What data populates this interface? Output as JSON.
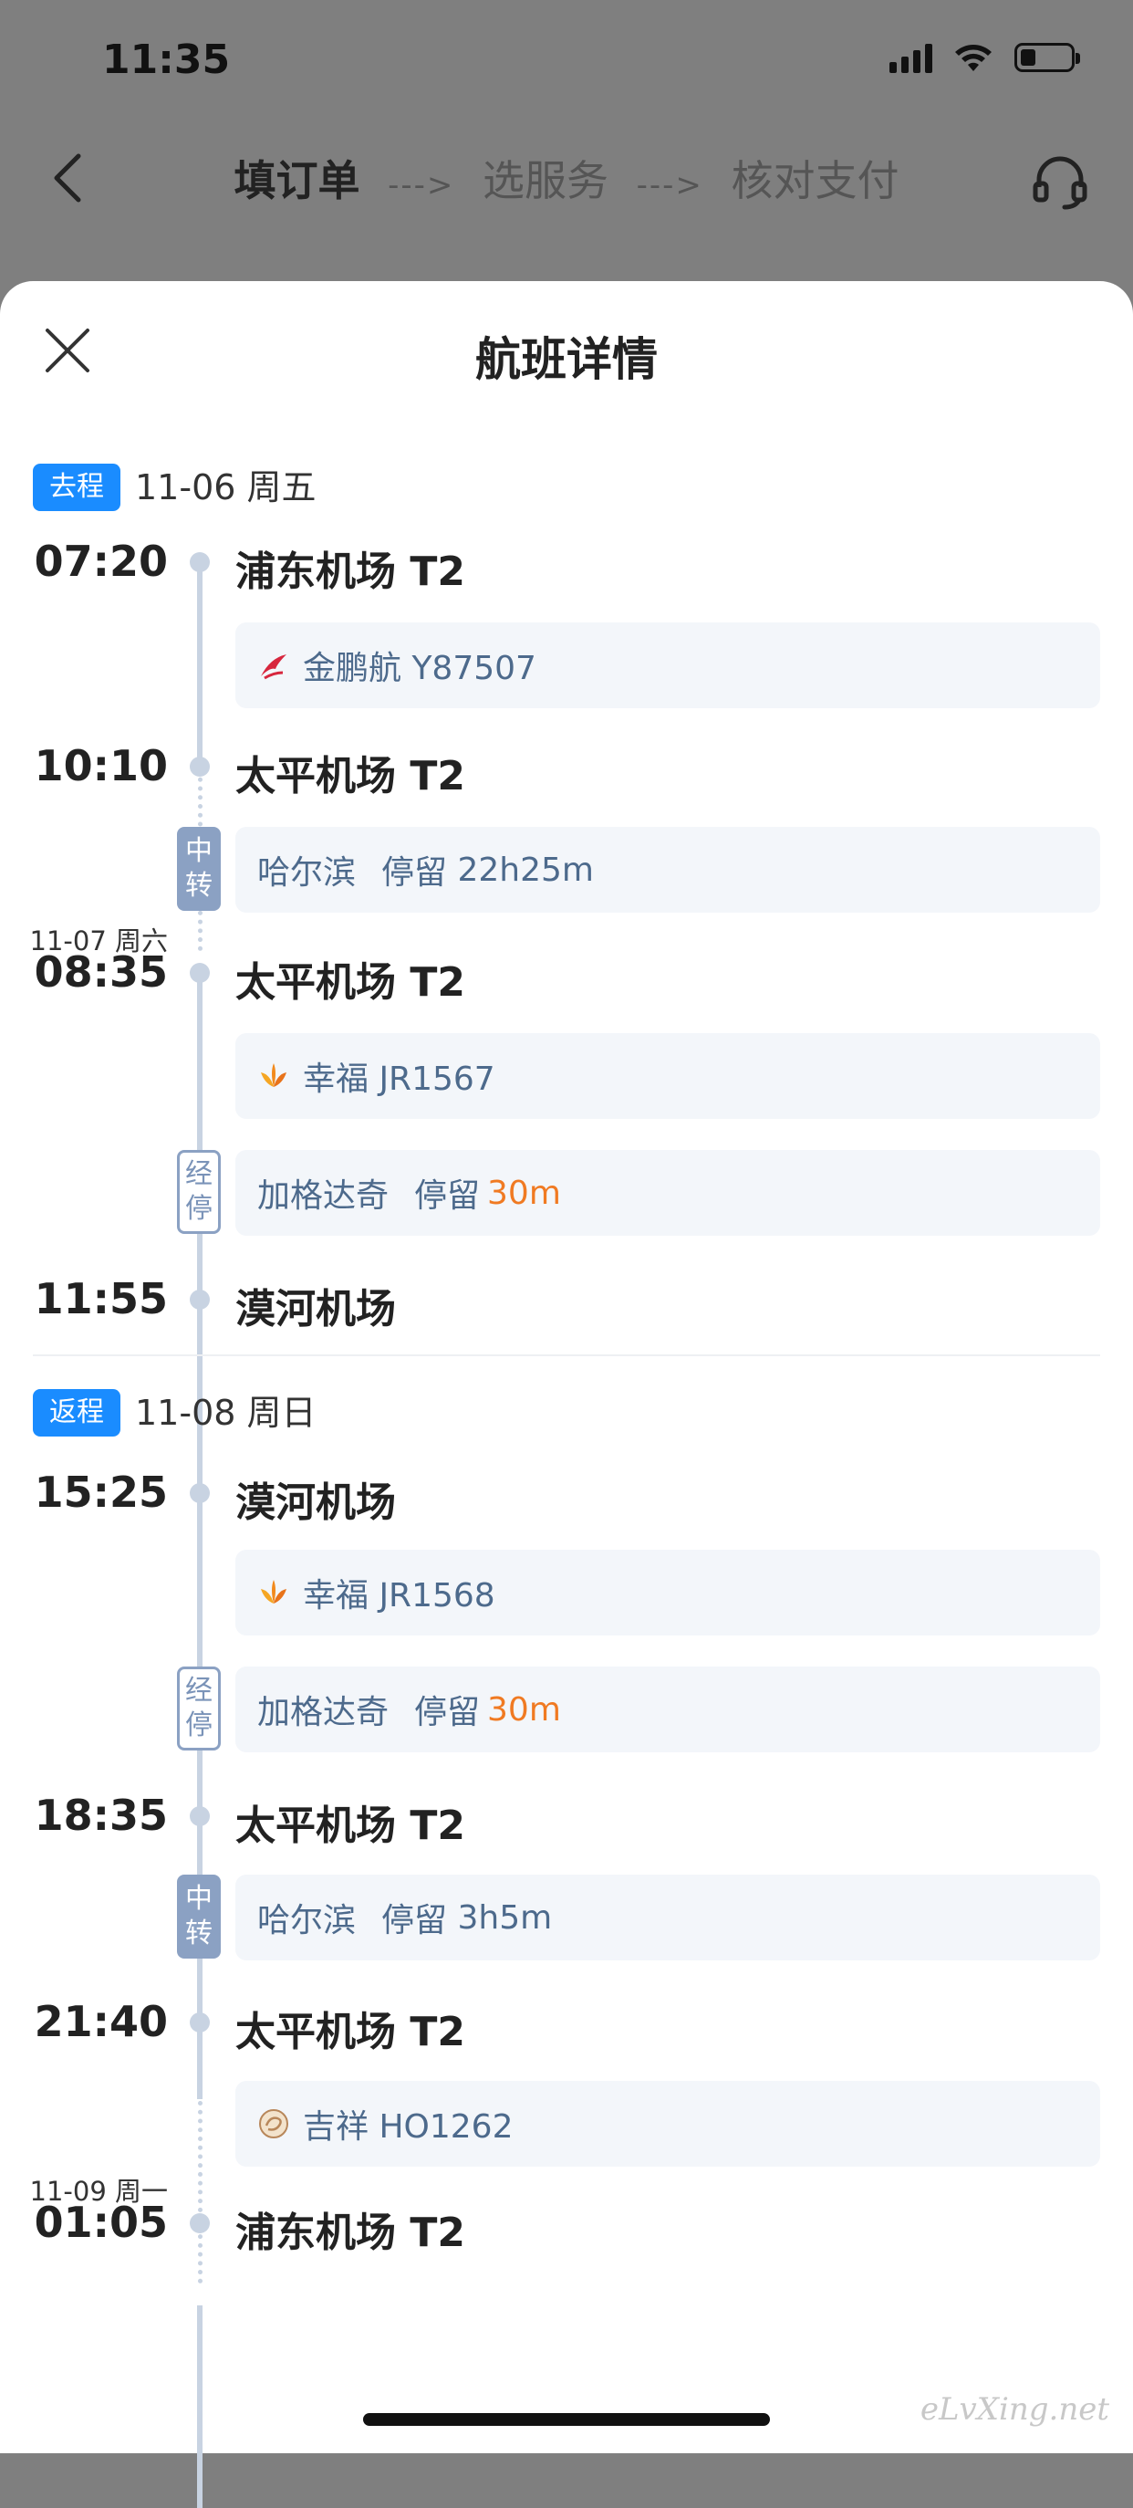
{
  "status_bar": {
    "time": "11:35",
    "battery_level": 0.3
  },
  "nav": {
    "steps": [
      "填订单",
      "选服务",
      "核对支付"
    ],
    "arrow": "--->"
  },
  "sheet": {
    "title": "航班详情"
  },
  "outbound": {
    "tag": "去程",
    "date": "11-06 周五",
    "seg1": {
      "dep_time": "07:20",
      "dep_airport": "浦东机场 T2",
      "flight": "金鹏航 Y87507",
      "arr_time": "10:10",
      "arr_airport": "太平机场 T2",
      "airline_icon": "jinpeng-airline-logo"
    },
    "transfer": {
      "badge": "中转",
      "city": "哈尔滨",
      "stay_label": "停留",
      "stay": "22h25m"
    },
    "seg2": {
      "dep_date": "11-07 周六",
      "dep_time": "08:35",
      "dep_airport": "太平机场 T2",
      "flight": "幸福 JR1567",
      "airline_icon": "joy-air-logo"
    },
    "stopover": {
      "badge": "经停",
      "city": "加格达奇",
      "stay_label": "停留",
      "stay": "30m"
    },
    "arrival": {
      "time": "11:55",
      "airport": "漠河机场"
    }
  },
  "return": {
    "tag": "返程",
    "date": "11-08 周日",
    "seg1": {
      "dep_time": "15:25",
      "dep_airport": "漠河机场",
      "flight": "幸福 JR1568",
      "airline_icon": "joy-air-logo"
    },
    "stopover": {
      "badge": "经停",
      "city": "加格达奇",
      "stay_label": "停留",
      "stay": "30m"
    },
    "seg1_arr": {
      "time": "18:35",
      "airport": "太平机场 T2"
    },
    "transfer": {
      "badge": "中转",
      "city": "哈尔滨",
      "stay_label": "停留",
      "stay": "3h5m"
    },
    "seg2": {
      "dep_time": "21:40",
      "dep_airport": "太平机场 T2",
      "flight": "吉祥 HO1262",
      "airline_icon": "juneyao-airline-logo"
    },
    "arrival": {
      "date": "11-09 周一",
      "time": "01:05",
      "airport": "浦东机场 T2"
    }
  },
  "watermark": "eLvXing.net",
  "colors": {
    "accent": "#1a8cff",
    "highlight": "#f07a22",
    "timeline": "#c8d3e2",
    "badge": "#8ba1c3"
  }
}
